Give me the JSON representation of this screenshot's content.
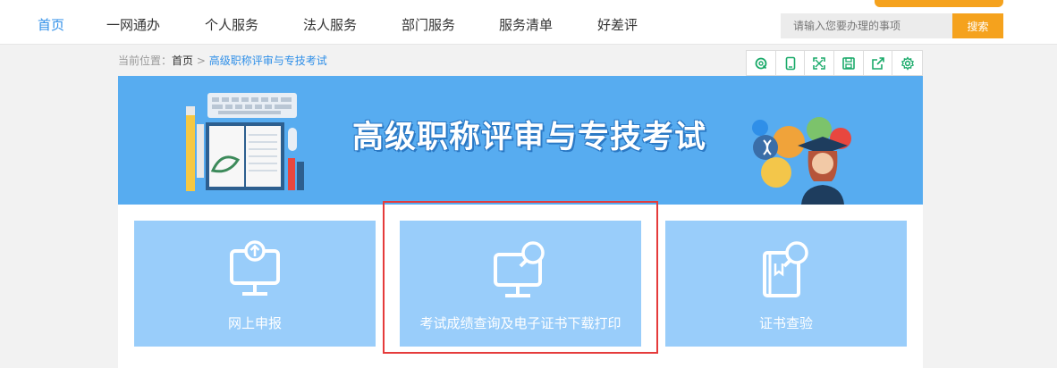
{
  "nav": {
    "items": [
      "首页",
      "一网通办",
      "个人服务",
      "法人服务",
      "部门服务",
      "服务清单",
      "好差评"
    ],
    "active_index": 0,
    "active_color": "#2f8fe8"
  },
  "search": {
    "placeholder": "请输入您要办理的事项",
    "button_label": "搜索",
    "accent_color": "#f5a21d"
  },
  "breadcrumb": {
    "prefix": "当前位置：",
    "home": "首页",
    "separator": " > ",
    "current": "高级职称评审与专技考试"
  },
  "tools": [
    "refresh-icon",
    "mobile-icon",
    "fullscreen-icon",
    "save-icon",
    "share-icon",
    "settings-icon"
  ],
  "banner": {
    "title": "高级职称评审与专技考试"
  },
  "cards": [
    {
      "label": "网上申报",
      "icon": "upload-monitor-icon"
    },
    {
      "label": "考试成绩查询及电子证书下载打印",
      "icon": "search-monitor-icon"
    },
    {
      "label": "证书查验",
      "icon": "certificate-search-icon"
    }
  ],
  "highlight_color": "#e53b3b"
}
